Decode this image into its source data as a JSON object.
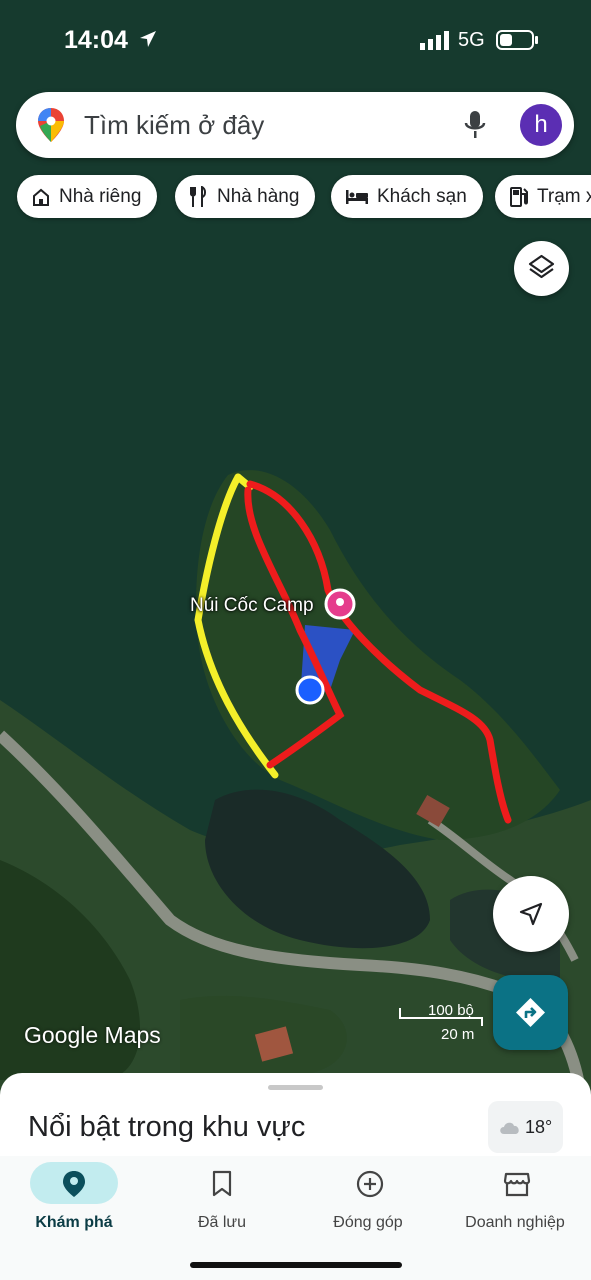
{
  "status_bar": {
    "time": "14:04",
    "network": "5G"
  },
  "search": {
    "placeholder": "Tìm kiếm ở đây",
    "avatar_letter": "h"
  },
  "chips": [
    {
      "label": "Nhà riêng",
      "icon": "home-icon"
    },
    {
      "label": "Nhà hàng",
      "icon": "restaurant-icon"
    },
    {
      "label": "Khách sạn",
      "icon": "hotel-icon"
    },
    {
      "label": "Trạm x",
      "icon": "gas-station-icon"
    }
  ],
  "map": {
    "place_label": "Núi Cốc Camp",
    "attribution": "Google Maps",
    "scale": {
      "imperial": "100 bộ",
      "metric": "20 m"
    }
  },
  "sheet": {
    "title": "Nổi bật trong khu vực",
    "temperature": "18°"
  },
  "nav": [
    {
      "label": "Khám phá",
      "icon": "explore-pin-icon",
      "active": true
    },
    {
      "label": "Đã lưu",
      "icon": "bookmark-icon",
      "active": false
    },
    {
      "label": "Đóng góp",
      "icon": "add-circle-icon",
      "active": false
    },
    {
      "label": "Doanh nghiệp",
      "icon": "store-icon",
      "active": false
    }
  ],
  "colors": {
    "water": "#163a2e",
    "accent": "#0b7285",
    "nav_active": "#c2ecef",
    "avatar": "#5b2eb3"
  }
}
